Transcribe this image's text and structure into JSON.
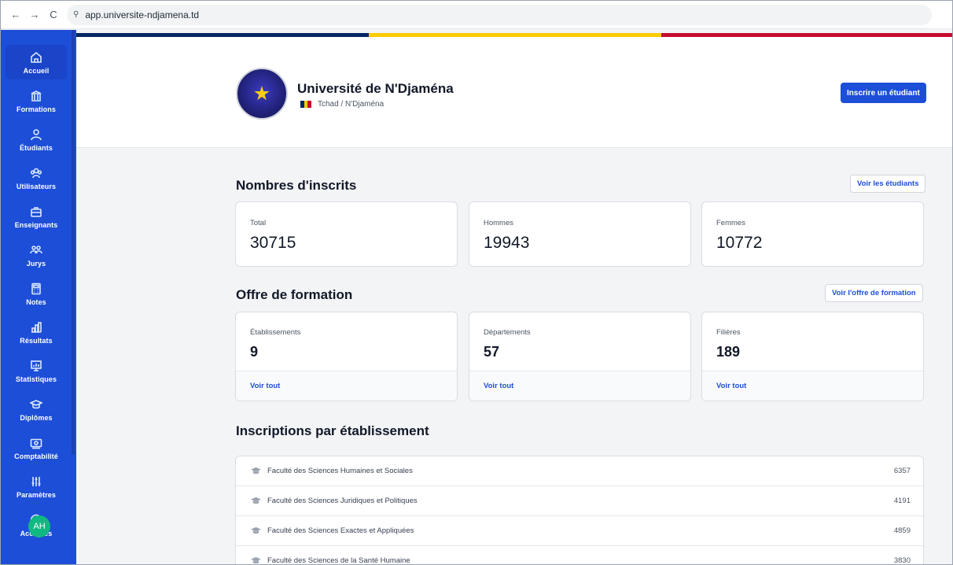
{
  "browser": {
    "back": "←",
    "forward": "→",
    "reload": "C",
    "site_info": "⚲",
    "url": "app.universite-ndjamena.td"
  },
  "sidebar": {
    "items": [
      {
        "label": "Accueil",
        "icon": "home-icon"
      },
      {
        "label": "Formations",
        "icon": "institution-icon"
      },
      {
        "label": "Étudiants",
        "icon": "user-icon"
      },
      {
        "label": "Utilisateurs",
        "icon": "users-icon"
      },
      {
        "label": "Enseignants",
        "icon": "briefcase-icon"
      },
      {
        "label": "Jurys",
        "icon": "group-icon"
      },
      {
        "label": "Notes",
        "icon": "calculator-icon"
      },
      {
        "label": "Résultats",
        "icon": "bar-chart-icon"
      },
      {
        "label": "Statistiques",
        "icon": "presentation-chart-icon"
      },
      {
        "label": "Diplômes",
        "icon": "graduation-cap-icon"
      },
      {
        "label": "Comptabilité",
        "icon": "banknote-icon"
      },
      {
        "label": "Paramètres",
        "icon": "sliders-icon"
      },
      {
        "label": "Acceptés",
        "icon": "smile-icon"
      }
    ],
    "avatar_initials": "AH"
  },
  "colors": {
    "brand": "#1d4ed8",
    "flag_blue": "#002664",
    "flag_yellow": "#fecb00",
    "flag_red": "#c60c30"
  },
  "header": {
    "university_name": "Université de N'Djaména",
    "location": "Tchad / N'Djaména",
    "enroll_button": "Inscrire un étudiant"
  },
  "enrollments": {
    "title": "Nombres d'inscrits",
    "view_button": "Voir les étudiants",
    "cards": [
      {
        "label": "Total",
        "value": "30715"
      },
      {
        "label": "Hommes",
        "value": "19943"
      },
      {
        "label": "Femmes",
        "value": "10772"
      }
    ]
  },
  "offer": {
    "title": "Offre de formation",
    "view_button": "Voir l'offre de formation",
    "cards": [
      {
        "label": "Établissements",
        "value": "9",
        "link": "Voir tout"
      },
      {
        "label": "Départements",
        "value": "57",
        "link": "Voir tout"
      },
      {
        "label": "Filières",
        "value": "189",
        "link": "Voir tout"
      }
    ]
  },
  "by_institution": {
    "title": "Inscriptions par établissement",
    "rows": [
      {
        "name": "Faculté des Sciences Humaines et Sociales",
        "count": "6357"
      },
      {
        "name": "Faculté des Sciences Juridiques et Politiques",
        "count": "4191"
      },
      {
        "name": "Faculté des Sciences Exactes et Appliquées",
        "count": "4859"
      },
      {
        "name": "Faculté des Sciences de la Santé Humaine",
        "count": "3830"
      }
    ]
  }
}
